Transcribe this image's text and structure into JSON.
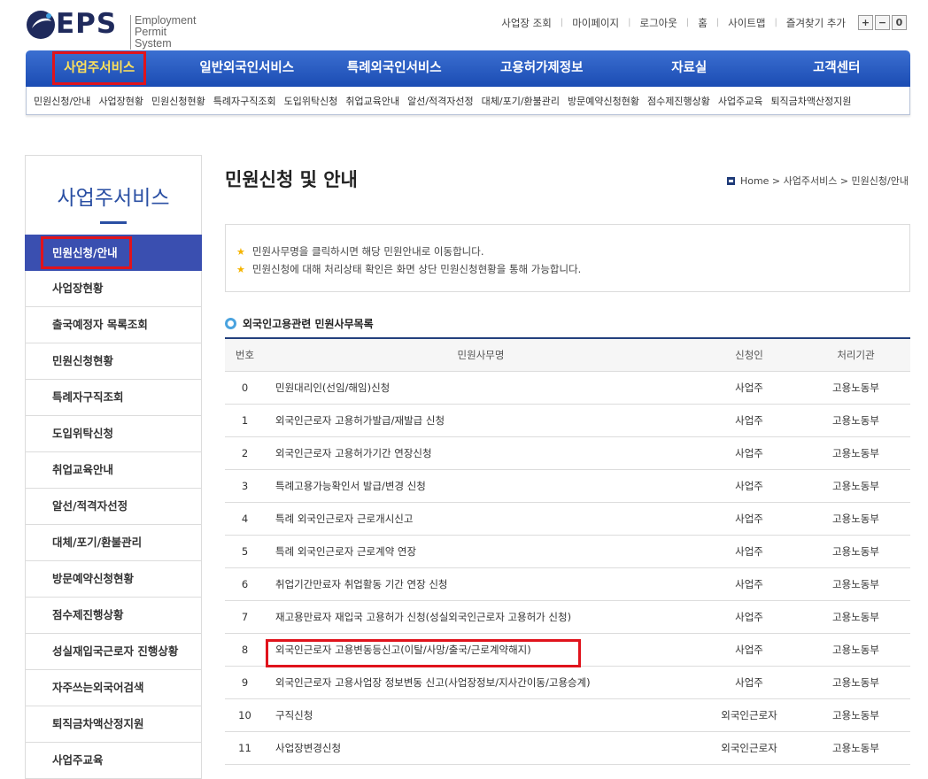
{
  "header": {
    "logo_text": "EPS",
    "logo_sub_1": "Employment",
    "logo_sub_2": "Permit System",
    "util_links": [
      "사업장 조회",
      "마이페이지",
      "로그아웃",
      "홈",
      "사이트맵",
      "즐겨찾기 추가"
    ],
    "zoom": [
      "+",
      "−",
      "0"
    ]
  },
  "gnb": {
    "items": [
      "사업주서비스",
      "일반외국인서비스",
      "특례외국인서비스",
      "고용허가제정보",
      "자료실",
      "고객센터"
    ],
    "active_index": 0
  },
  "subnav": {
    "items": [
      "민원신청/안내",
      "사업장현황",
      "민원신청현황",
      "특례자구직조회",
      "도입위탁신청",
      "취업교육안내",
      "알선/적격자선정",
      "대체/포기/환불관리",
      "방문예약신청현황",
      "점수제진행상황",
      "사업주교육",
      "퇴직금차액산정지원"
    ]
  },
  "sidebar": {
    "title": "사업주서비스",
    "items": [
      "민원신청/안내",
      "사업장현황",
      "출국예정자 목록조회",
      "민원신청현황",
      "특례자구직조회",
      "도입위탁신청",
      "취업교육안내",
      "알선/적격자선정",
      "대체/포기/환불관리",
      "방문예약신청현황",
      "점수제진행상황",
      "성실재입국근로자 진행상황",
      "자주쓰는외국어검색",
      "퇴직금차액산정지원",
      "사업주교육"
    ],
    "active_index": 0
  },
  "content": {
    "page_title": "민원신청 및 안내",
    "breadcrumb": "Home > 사업주서비스 > 민원신청/안내",
    "notices": [
      "민원사무명을 클릭하시면 해당 민원안내로 이동합니다.",
      "민원신청에 대해 처리상태 확인은 화면 상단 민원신청현황을 통해 가능합니다."
    ],
    "section_title": "외국인고용관련 민원사무목록"
  },
  "table": {
    "headers": {
      "no": "번호",
      "name": "민원사무명",
      "applicant": "신청인",
      "agency": "처리기관"
    },
    "rows": [
      {
        "no": "0",
        "name": "민원대리인(선임/해임)신청",
        "applicant": "사업주",
        "agency": "고용노동부"
      },
      {
        "no": "1",
        "name": "외국인근로자 고용허가발급/재발급 신청",
        "applicant": "사업주",
        "agency": "고용노동부"
      },
      {
        "no": "2",
        "name": "외국인근로자 고용허가기간 연장신청",
        "applicant": "사업주",
        "agency": "고용노동부"
      },
      {
        "no": "3",
        "name": "특례고용가능확인서 발급/변경 신청",
        "applicant": "사업주",
        "agency": "고용노동부"
      },
      {
        "no": "4",
        "name": "특례 외국인근로자 근로개시신고",
        "applicant": "사업주",
        "agency": "고용노동부"
      },
      {
        "no": "5",
        "name": "특례 외국인근로자 근로계약 연장",
        "applicant": "사업주",
        "agency": "고용노동부"
      },
      {
        "no": "6",
        "name": "취업기간만료자 취업활동 기간 연장 신청",
        "applicant": "사업주",
        "agency": "고용노동부"
      },
      {
        "no": "7",
        "name": "재고용만료자 재입국 고용허가 신청(성실외국인근로자 고용허가 신청)",
        "applicant": "사업주",
        "agency": "고용노동부"
      },
      {
        "no": "8",
        "name": "외국인근로자 고용변동등신고(이탈/사망/출국/근로계약해지)",
        "applicant": "사업주",
        "agency": "고용노동부"
      },
      {
        "no": "9",
        "name": "외국인근로자 고용사업장 정보변동 신고(사업장정보/지사간이동/고용승계)",
        "applicant": "사업주",
        "agency": "고용노동부"
      },
      {
        "no": "10",
        "name": "구직신청",
        "applicant": "외국인근로자",
        "agency": "고용노동부"
      },
      {
        "no": "11",
        "name": "사업장변경신청",
        "applicant": "외국인근로자",
        "agency": "고용노동부"
      }
    ]
  },
  "colors": {
    "accent": "#2a4fa3",
    "highlight": "#e0131c",
    "gnb_active": "#ffe15a"
  }
}
